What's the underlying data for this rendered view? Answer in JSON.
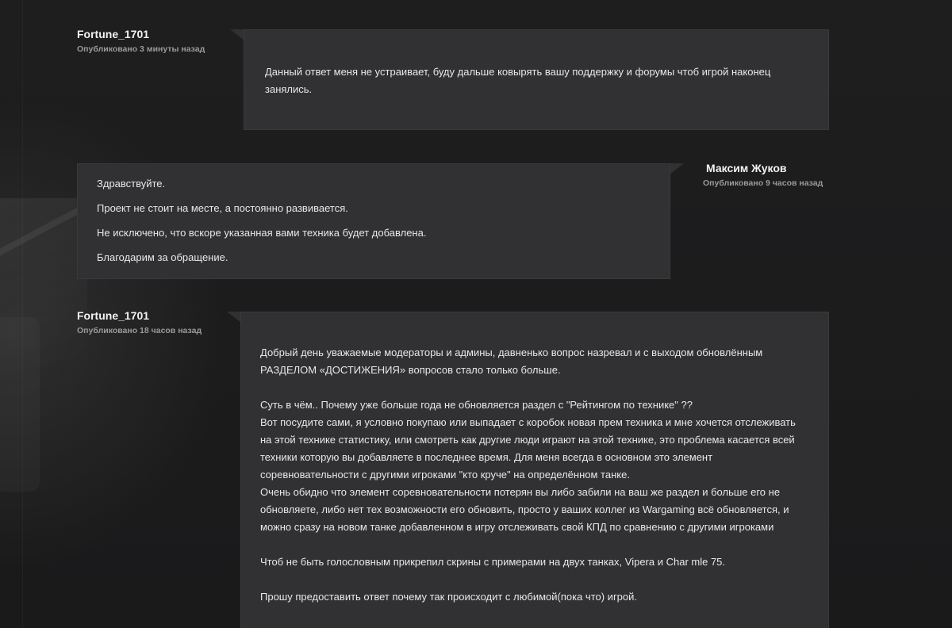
{
  "messages": [
    {
      "author": "Fortune_1701",
      "time": "Опубликовано 3 минуты назад",
      "paragraphs": [
        "Данный ответ меня не устраивает, буду дальше ковырять вашу поддержку и форумы чтоб игрой наконец занялись."
      ]
    },
    {
      "author": "Максим Жуков",
      "time": "Опубликовано 9 часов назад",
      "paragraphs": [
        "Здравствуйте.",
        "Проект не стоит на месте, а постоянно развивается.",
        "Не исключено, что вскоре указанная вами техника будет добавлена.",
        "Благодарим за обращение."
      ]
    },
    {
      "author": "Fortune_1701",
      "time": "Опубликовано 18 часов назад",
      "paragraphs": [
        "Добрый день уважаемые модераторы и админы, давненько вопрос назревал и с выходом обновлённым РАЗДЕЛОМ «ДОСТИЖЕНИЯ» вопросов стало только больше.",
        "Суть в чём.. Почему уже больше года не обновляется раздел с \"Рейтингом по технике\" ??\nВот посудите сами, я условно покупаю или выпадает с коробок новая прем техника и мне хочется отслеживать на этой технике статистику, или смотреть как другие люди играют на этой технике, это проблема касается всей техники которую вы добавляете в последнее время. Для меня всегда в основном это элемент соревновательности с другими игроками \"кто круче\" на определённом танке.\nОчень обидно что элемент соревновательности потерян вы либо забили на ваш же раздел и больше его не обновляете, либо нет тех возможности его обновить, просто у ваших коллег из Wargaming всё обновляется, и можно сразу на новом танке добавленном в игру отслеживать свой КПД по сравнению с другими игроками",
        "Чтоб не быть голословным прикрепил скрины с примерами на двух танках, Vipera и Char mle 75.",
        "Прошу предоставить ответ почему так происходит с любимой(пока что) игрой."
      ]
    }
  ]
}
